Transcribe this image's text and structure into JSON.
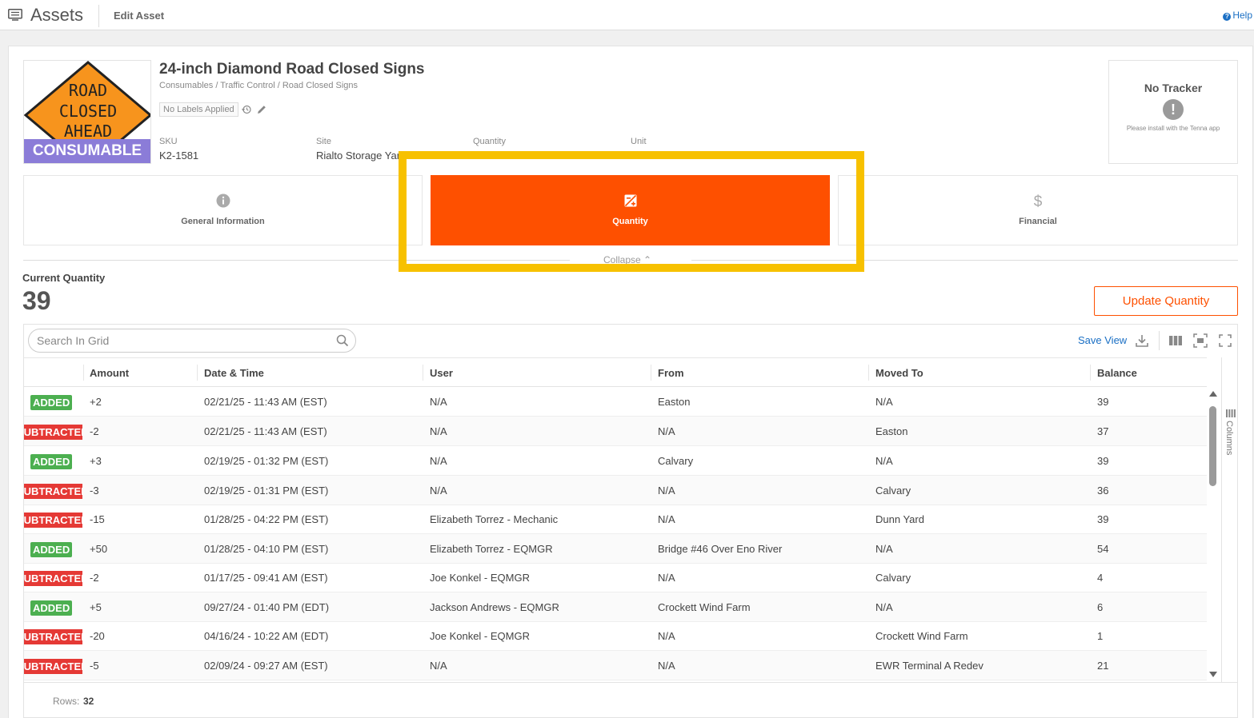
{
  "topbar": {
    "app_title": "Assets",
    "breadcrumb": "Edit Asset",
    "help": "Help"
  },
  "asset": {
    "title": "24-inch Diamond Road Closed Signs",
    "path": "Consumables / Traffic Control / Road Closed Signs",
    "labels": "No Labels Applied",
    "badge": "CONSUMABLE",
    "sign_lines": [
      "ROAD",
      "CLOSED",
      "AHEAD"
    ],
    "fields": {
      "sku_label": "SKU",
      "sku_value": "K2-1581",
      "site_label": "Site",
      "site_value": "Rialto Storage Yard",
      "quantity_label": "Quantity",
      "unit_label": "Unit"
    }
  },
  "tracker": {
    "title": "No Tracker",
    "note": "Please install with the Tenna app"
  },
  "tabs": {
    "general": "General Information",
    "quantity": "Quantity",
    "financial": "Financial",
    "collapse": "Collapse"
  },
  "current_quantity": {
    "label": "Current Quantity",
    "value": "39"
  },
  "update_button": "Update Quantity",
  "grid": {
    "search_placeholder": "Search In Grid",
    "save_view": "Save View",
    "columns_label": "Columns",
    "headers": {
      "amount": "Amount",
      "datetime": "Date & Time",
      "user": "User",
      "from": "From",
      "moved_to": "Moved To",
      "balance": "Balance"
    },
    "rows": [
      {
        "type": "ADDED",
        "amount": "+2",
        "datetime": "02/21/25 - 11:43 AM (EST)",
        "user": "N/A",
        "from": "Easton",
        "moved_to": "N/A",
        "balance": "39"
      },
      {
        "type": "SUBTRACTED",
        "amount": "-2",
        "datetime": "02/21/25 - 11:43 AM (EST)",
        "user": "N/A",
        "from": "N/A",
        "moved_to": "Easton",
        "balance": "37"
      },
      {
        "type": "ADDED",
        "amount": "+3",
        "datetime": "02/19/25 - 01:32 PM (EST)",
        "user": "N/A",
        "from": "Calvary",
        "moved_to": "N/A",
        "balance": "39"
      },
      {
        "type": "SUBTRACTED",
        "amount": "-3",
        "datetime": "02/19/25 - 01:31 PM (EST)",
        "user": "N/A",
        "from": "N/A",
        "moved_to": "Calvary",
        "balance": "36"
      },
      {
        "type": "SUBTRACTED",
        "amount": "-15",
        "datetime": "01/28/25 - 04:22 PM (EST)",
        "user": "Elizabeth Torrez - Mechanic",
        "from": "N/A",
        "moved_to": "Dunn Yard",
        "balance": "39"
      },
      {
        "type": "ADDED",
        "amount": "+50",
        "datetime": "01/28/25 - 04:10 PM (EST)",
        "user": "Elizabeth Torrez - EQMGR",
        "from": "Bridge #46 Over Eno River",
        "moved_to": "N/A",
        "balance": "54"
      },
      {
        "type": "SUBTRACTED",
        "amount": "-2",
        "datetime": "01/17/25 - 09:41 AM (EST)",
        "user": "Joe Konkel - EQMGR",
        "from": "N/A",
        "moved_to": "Calvary",
        "balance": "4"
      },
      {
        "type": "ADDED",
        "amount": "+5",
        "datetime": "09/27/24 - 01:40 PM (EDT)",
        "user": "Jackson Andrews - EQMGR",
        "from": "Crockett Wind Farm",
        "moved_to": "N/A",
        "balance": "6"
      },
      {
        "type": "SUBTRACTED",
        "amount": "-20",
        "datetime": "04/16/24 - 10:22 AM (EDT)",
        "user": "Joe Konkel - EQMGR",
        "from": "N/A",
        "moved_to": "Crockett Wind Farm",
        "balance": "1"
      },
      {
        "type": "SUBTRACTED",
        "amount": "-5",
        "datetime": "02/09/24 - 09:27 AM (EST)",
        "user": "N/A",
        "from": "N/A",
        "moved_to": "EWR Terminal A Redev",
        "balance": "21"
      }
    ],
    "rows_label": "Rows:",
    "rows_count": "32"
  },
  "colors": {
    "accent": "#fe5000",
    "added": "#4caf50",
    "subtracted": "#e53935",
    "consumable": "#8b7cd8",
    "highlight": "#f7c100",
    "link": "#1a6fc4"
  }
}
